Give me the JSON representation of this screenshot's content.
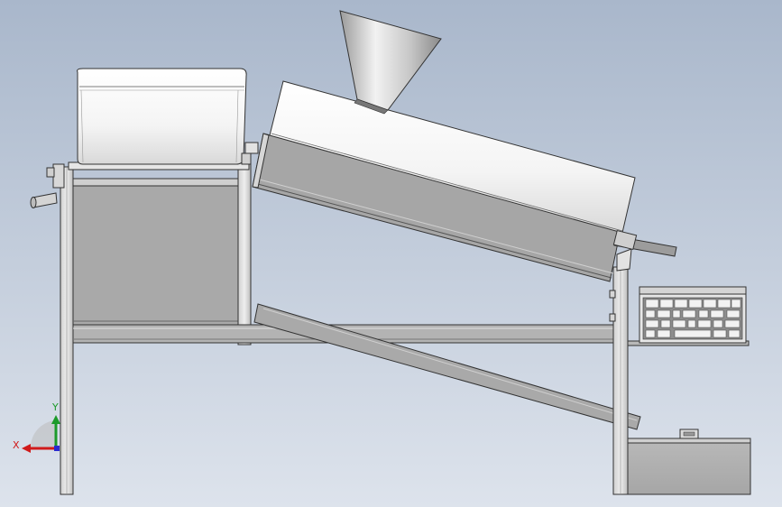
{
  "view": {
    "background_top": "#a9b7cb",
    "background_bottom": "#dde3ec"
  },
  "triad": {
    "x_label": "X",
    "y_label": "Y",
    "x_color": "#d01a1a",
    "y_color": "#1c9a2a",
    "z_color": "#2a2ad0"
  }
}
